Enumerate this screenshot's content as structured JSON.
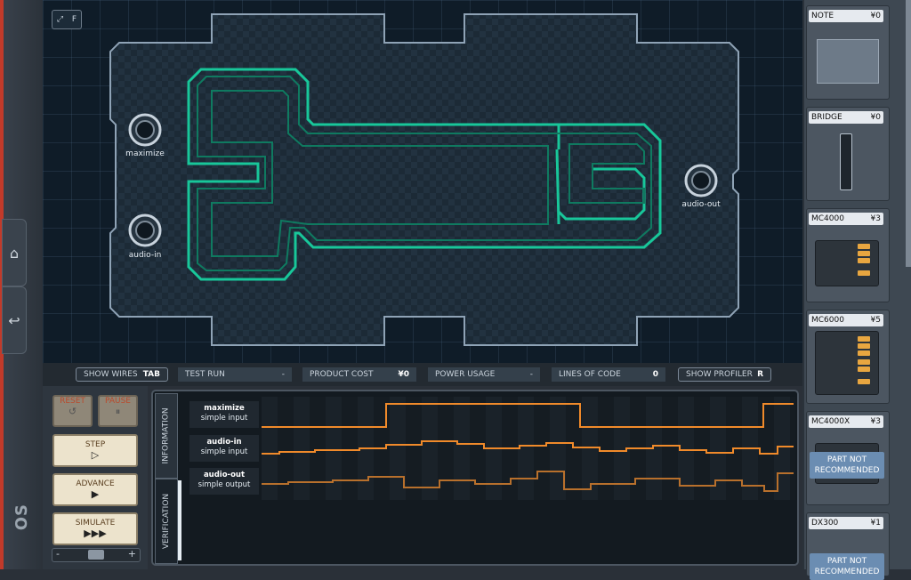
{
  "toolbar": {
    "fullscreen_key": "F"
  },
  "board": {
    "pins": [
      {
        "label": "maximize"
      },
      {
        "label": "audio-in"
      },
      {
        "label": "audio-out"
      }
    ]
  },
  "status": {
    "show_wires": {
      "label": "SHOW WIRES",
      "key": "TAB"
    },
    "test_run": {
      "label": "TEST RUN",
      "value": "-"
    },
    "product_cost": {
      "label": "PRODUCT COST",
      "value": "¥0"
    },
    "power_usage": {
      "label": "POWER USAGE",
      "value": "-"
    },
    "lines_of_code": {
      "label": "LINES OF CODE",
      "value": "0"
    },
    "show_profiler": {
      "label": "SHOW PROFILER",
      "key": "R"
    }
  },
  "controls": {
    "reset": {
      "label": "RESET",
      "glyph": "↺"
    },
    "pause": {
      "label": "PAUSE",
      "glyph": "⏸"
    },
    "step": {
      "label": "STEP",
      "glyph": "▷"
    },
    "advance": {
      "label": "ADVANCE",
      "glyph": "▶"
    },
    "simulate": {
      "label": "SIMULATE",
      "glyph": "▶▶▶"
    },
    "speed_minus": "-",
    "speed_plus": "+"
  },
  "verification": {
    "tabs": [
      "INFORMATION",
      "VERIFICATION"
    ],
    "signals": [
      {
        "name": "maximize",
        "kind": "simple input"
      },
      {
        "name": "audio-in",
        "kind": "simple input"
      },
      {
        "name": "audio-out",
        "kind": "simple output"
      }
    ]
  },
  "parts": [
    {
      "name": "NOTE",
      "price": "¥0"
    },
    {
      "name": "BRIDGE",
      "price": "¥0"
    },
    {
      "name": "MC4000",
      "price": "¥3"
    },
    {
      "name": "MC6000",
      "price": "¥5"
    },
    {
      "name": "MC4000X",
      "price": "¥3",
      "overlay": "PART NOT RECOMMENDED"
    },
    {
      "name": "DX300",
      "price": "¥1",
      "overlay": "PART NOT RECOMMENDED"
    }
  ],
  "colors": {
    "trace": "#18c79a",
    "signal": "#f08a2a",
    "accent_red": "#c13a2a"
  }
}
